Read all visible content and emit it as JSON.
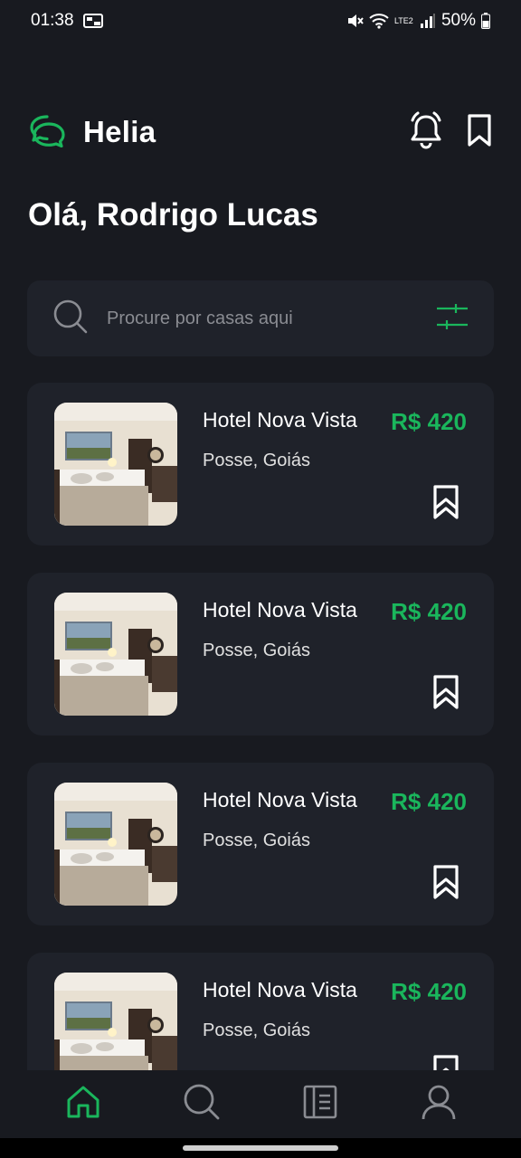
{
  "status_bar": {
    "time": "01:38",
    "battery": "50%",
    "network": "LTE2",
    "icons": [
      "photo-icon",
      "mute-icon",
      "wifi-icon",
      "signal-icon",
      "battery-icon"
    ]
  },
  "header": {
    "app_name": "Helia",
    "icons": [
      "logo-icon",
      "bell-icon",
      "bookmark-icon"
    ]
  },
  "greeting": "Olá, Rodrigo Lucas",
  "search": {
    "placeholder": "Procure por casas aqui",
    "icons": [
      "search-icon",
      "filter-icon"
    ]
  },
  "hotels": [
    {
      "name": "Hotel Nova Vista",
      "location": "Posse, Goiás",
      "price": "R$ 420"
    },
    {
      "name": "Hotel Nova Vista",
      "location": "Posse, Goiás",
      "price": "R$ 420"
    },
    {
      "name": "Hotel Nova Vista",
      "location": "Posse, Goiás",
      "price": "R$ 420"
    },
    {
      "name": "Hotel Nova Vista",
      "location": "Posse, Goiás",
      "price": "R$ 420"
    }
  ],
  "bottom_nav": {
    "items": [
      "home-icon",
      "search-icon",
      "bookings-icon",
      "profile-icon"
    ],
    "active": "home-icon"
  },
  "colors": {
    "background": "#181a20",
    "card": "#1f222a",
    "accent": "#1ab65c",
    "text": "#ffffff",
    "muted": "#9e9e9e"
  }
}
